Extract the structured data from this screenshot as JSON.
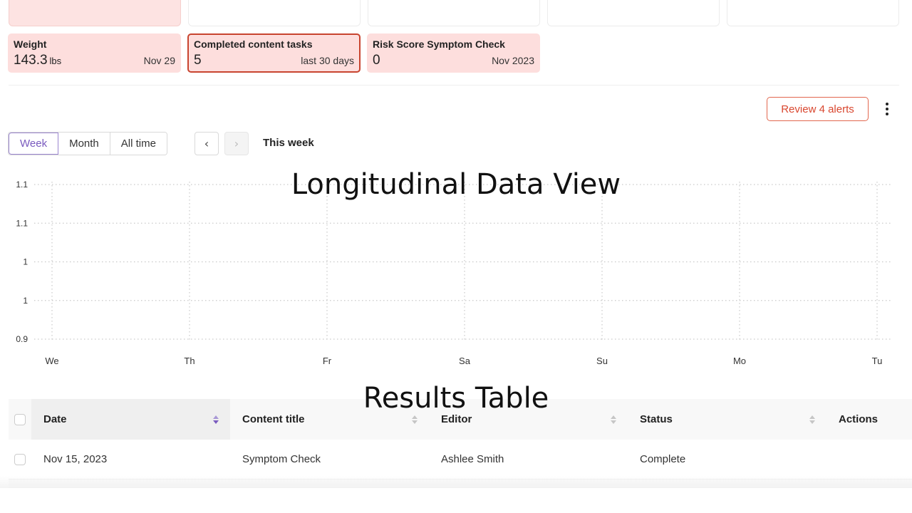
{
  "stat_cards": [
    {
      "title": "Weight",
      "value": "143.3",
      "unit": "lbs",
      "meta": "Nov 29",
      "selected": false
    },
    {
      "title": "Completed content tasks",
      "value": "5",
      "unit": "",
      "meta": "last 30 days",
      "selected": true
    },
    {
      "title": "Risk Score Symptom Check",
      "value": "0",
      "unit": "",
      "meta": "Nov 2023",
      "selected": false
    }
  ],
  "toolbar": {
    "review_label": "Review 4 alerts",
    "range_options": [
      "Week",
      "Month",
      "All time"
    ],
    "active_range": "Week",
    "prev_icon": "chevron-left-icon",
    "next_icon": "chevron-right-icon",
    "period_label": "This week"
  },
  "overlays": {
    "chart_caption": "Longitudinal Data View",
    "table_caption": "Results Table"
  },
  "chart_data": {
    "type": "line",
    "title": "",
    "xlabel": "",
    "ylabel": "",
    "x": [
      "We",
      "Th",
      "Fr",
      "Sa",
      "Su",
      "Mo",
      "Tu"
    ],
    "y_ticks": [
      "1.1",
      "1.1",
      "1",
      "1",
      "0.9"
    ],
    "series": [],
    "grid": true,
    "grid_style": "dotted"
  },
  "table": {
    "columns": [
      {
        "label": "Date",
        "sortable": true,
        "sorted": true
      },
      {
        "label": "Content title",
        "sortable": true,
        "sorted": false
      },
      {
        "label": "Editor",
        "sortable": true,
        "sorted": false
      },
      {
        "label": "Status",
        "sortable": true,
        "sorted": false
      },
      {
        "label": "Actions",
        "sortable": false,
        "sorted": false
      }
    ],
    "rows": [
      {
        "date": "Nov 15, 2023",
        "title": "Symptom Check",
        "editor": "Ashlee Smith",
        "status": "Complete",
        "actions": ""
      }
    ]
  },
  "colors": {
    "card_bg": "#fddedd",
    "accent_red": "#d9472f",
    "accent_purple": "#7a5bbf",
    "grid": "#c9c9c9"
  }
}
